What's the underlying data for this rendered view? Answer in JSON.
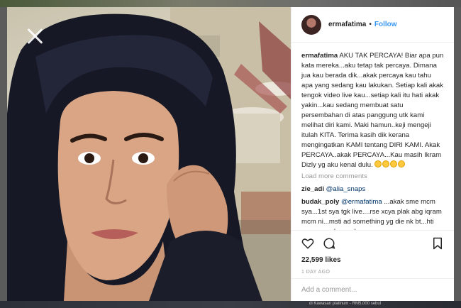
{
  "post": {
    "username": "ermafatima",
    "follow_label": "Follow",
    "separator": "•"
  },
  "caption": {
    "username": "ermafatima",
    "text": " AKU TAK PERCAYA! Biar apa pun kata mereka...aku tetap tak percaya. Dimana jua kau berada dik...akak percaya kau tahu apa yang sedang kau lakukan. Setiap kali akak tengok video live kau...setiap kali itu hati akak yakin...kau sedang membuat satu persembahan di atas panggung utk kami melihat diri kami. Maki hamun..keji mengeji itulah KITA. Terima kasih dik kerana mengingatkan KAMI tentang DIRI KAMI. Akak PERCAYA..akak PERCAYA...Kau masih Ikram Dizly yg aku kenal dulu. "
  },
  "load_more_label": "Load more comments",
  "comments": [
    {
      "user": "zie_adi",
      "mention": "@alia_snaps",
      "text": ""
    },
    {
      "user": "budak_poly",
      "mention": "@ermafatima",
      "text": " ...akak sme mcm sya...1st sya tgk live....rse xcya plak abg iqram mcm ni...msti ad something yg die nk bt...hti sya mcm ckap...abg"
    }
  ],
  "likes_label": "22,599 likes",
  "time_label": "1 DAY AGO",
  "add_comment_placeholder": "Add a comment...",
  "bottom_caption": "di Kawasan platinum - RM5,000 sebul",
  "icons": {
    "close": "close-icon",
    "heart": "heart-icon",
    "comment": "comment-bubble-icon",
    "bookmark": "bookmark-icon"
  },
  "colors": {
    "link": "#3897f0",
    "text": "#262626",
    "muted": "#999999"
  }
}
